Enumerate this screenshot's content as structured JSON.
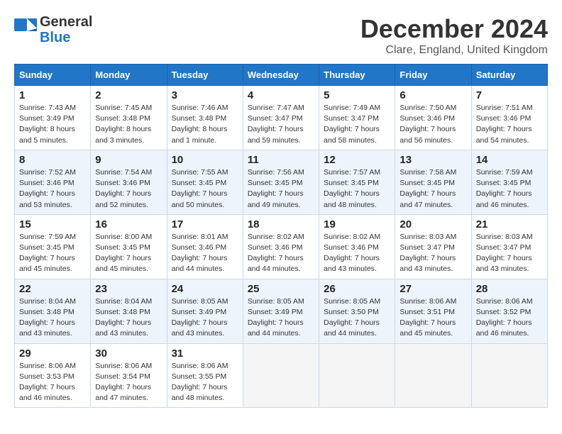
{
  "header": {
    "logo": {
      "general": "General",
      "blue": "Blue",
      "tagline": ""
    },
    "title": "December 2024",
    "location": "Clare, England, United Kingdom"
  },
  "days_of_week": [
    "Sunday",
    "Monday",
    "Tuesday",
    "Wednesday",
    "Thursday",
    "Friday",
    "Saturday"
  ],
  "weeks": [
    [
      {
        "day": "1",
        "sunrise": "7:43 AM",
        "sunset": "3:49 PM",
        "daylight": "8 hours and 5 minutes."
      },
      {
        "day": "2",
        "sunrise": "7:45 AM",
        "sunset": "3:48 PM",
        "daylight": "8 hours and 3 minutes."
      },
      {
        "day": "3",
        "sunrise": "7:46 AM",
        "sunset": "3:48 PM",
        "daylight": "8 hours and 1 minute."
      },
      {
        "day": "4",
        "sunrise": "7:47 AM",
        "sunset": "3:47 PM",
        "daylight": "7 hours and 59 minutes."
      },
      {
        "day": "5",
        "sunrise": "7:49 AM",
        "sunset": "3:47 PM",
        "daylight": "7 hours and 58 minutes."
      },
      {
        "day": "6",
        "sunrise": "7:50 AM",
        "sunset": "3:46 PM",
        "daylight": "7 hours and 56 minutes."
      },
      {
        "day": "7",
        "sunrise": "7:51 AM",
        "sunset": "3:46 PM",
        "daylight": "7 hours and 54 minutes."
      }
    ],
    [
      {
        "day": "8",
        "sunrise": "7:52 AM",
        "sunset": "3:46 PM",
        "daylight": "7 hours and 53 minutes."
      },
      {
        "day": "9",
        "sunrise": "7:54 AM",
        "sunset": "3:46 PM",
        "daylight": "7 hours and 52 minutes."
      },
      {
        "day": "10",
        "sunrise": "7:55 AM",
        "sunset": "3:45 PM",
        "daylight": "7 hours and 50 minutes."
      },
      {
        "day": "11",
        "sunrise": "7:56 AM",
        "sunset": "3:45 PM",
        "daylight": "7 hours and 49 minutes."
      },
      {
        "day": "12",
        "sunrise": "7:57 AM",
        "sunset": "3:45 PM",
        "daylight": "7 hours and 48 minutes."
      },
      {
        "day": "13",
        "sunrise": "7:58 AM",
        "sunset": "3:45 PM",
        "daylight": "7 hours and 47 minutes."
      },
      {
        "day": "14",
        "sunrise": "7:59 AM",
        "sunset": "3:45 PM",
        "daylight": "7 hours and 46 minutes."
      }
    ],
    [
      {
        "day": "15",
        "sunrise": "7:59 AM",
        "sunset": "3:45 PM",
        "daylight": "7 hours and 45 minutes."
      },
      {
        "day": "16",
        "sunrise": "8:00 AM",
        "sunset": "3:45 PM",
        "daylight": "7 hours and 45 minutes."
      },
      {
        "day": "17",
        "sunrise": "8:01 AM",
        "sunset": "3:46 PM",
        "daylight": "7 hours and 44 minutes."
      },
      {
        "day": "18",
        "sunrise": "8:02 AM",
        "sunset": "3:46 PM",
        "daylight": "7 hours and 44 minutes."
      },
      {
        "day": "19",
        "sunrise": "8:02 AM",
        "sunset": "3:46 PM",
        "daylight": "7 hours and 43 minutes."
      },
      {
        "day": "20",
        "sunrise": "8:03 AM",
        "sunset": "3:47 PM",
        "daylight": "7 hours and 43 minutes."
      },
      {
        "day": "21",
        "sunrise": "8:03 AM",
        "sunset": "3:47 PM",
        "daylight": "7 hours and 43 minutes."
      }
    ],
    [
      {
        "day": "22",
        "sunrise": "8:04 AM",
        "sunset": "3:48 PM",
        "daylight": "7 hours and 43 minutes."
      },
      {
        "day": "23",
        "sunrise": "8:04 AM",
        "sunset": "3:48 PM",
        "daylight": "7 hours and 43 minutes."
      },
      {
        "day": "24",
        "sunrise": "8:05 AM",
        "sunset": "3:49 PM",
        "daylight": "7 hours and 43 minutes."
      },
      {
        "day": "25",
        "sunrise": "8:05 AM",
        "sunset": "3:49 PM",
        "daylight": "7 hours and 44 minutes."
      },
      {
        "day": "26",
        "sunrise": "8:05 AM",
        "sunset": "3:50 PM",
        "daylight": "7 hours and 44 minutes."
      },
      {
        "day": "27",
        "sunrise": "8:06 AM",
        "sunset": "3:51 PM",
        "daylight": "7 hours and 45 minutes."
      },
      {
        "day": "28",
        "sunrise": "8:06 AM",
        "sunset": "3:52 PM",
        "daylight": "7 hours and 46 minutes."
      }
    ],
    [
      {
        "day": "29",
        "sunrise": "8:06 AM",
        "sunset": "3:53 PM",
        "daylight": "7 hours and 46 minutes."
      },
      {
        "day": "30",
        "sunrise": "8:06 AM",
        "sunset": "3:54 PM",
        "daylight": "7 hours and 47 minutes."
      },
      {
        "day": "31",
        "sunrise": "8:06 AM",
        "sunset": "3:55 PM",
        "daylight": "7 hours and 48 minutes."
      },
      null,
      null,
      null,
      null
    ]
  ]
}
